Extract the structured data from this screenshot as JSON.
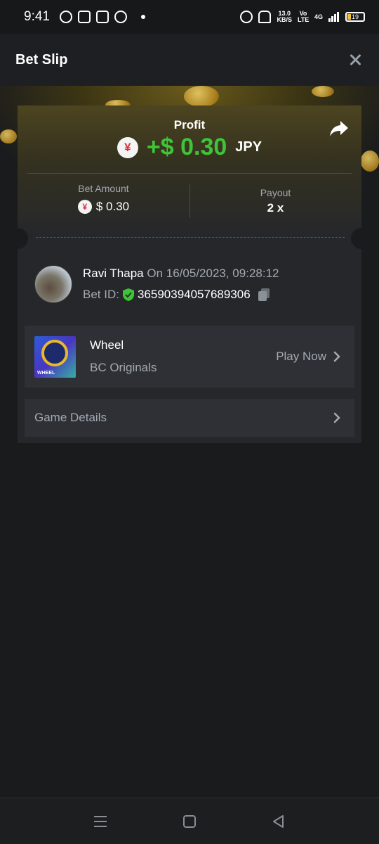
{
  "status_bar": {
    "time": "9:41",
    "net_speed": "13.0",
    "net_unit": "KB/S",
    "volte": "Vo LTE",
    "signal": "4G",
    "battery": "19"
  },
  "header": {
    "title": "Bet Slip"
  },
  "profit": {
    "label": "Profit",
    "currency_symbol": "¥",
    "value": "+$ 0.30",
    "currency": "JPY",
    "value_color": "#3fc438"
  },
  "stats": {
    "bet_amount_label": "Bet Amount",
    "bet_amount_value": "$ 0.30",
    "payout_label": "Payout",
    "payout_value": "2 x"
  },
  "user": {
    "name": "Ravi Thapa",
    "date": "On 16/05/2023, 09:28:12",
    "bet_id_label": "Bet ID:",
    "bet_id": "36590394057689306"
  },
  "game": {
    "name": "Wheel",
    "provider": "BC Originals",
    "thumb_text": "WHEEL",
    "play_label": "Play Now"
  },
  "details": {
    "label": "Game Details"
  },
  "icons": {
    "share": "share-icon",
    "close": "close-icon",
    "copy": "copy-icon",
    "shield": "shield-check-icon",
    "chevron": "chevron-right-icon"
  }
}
